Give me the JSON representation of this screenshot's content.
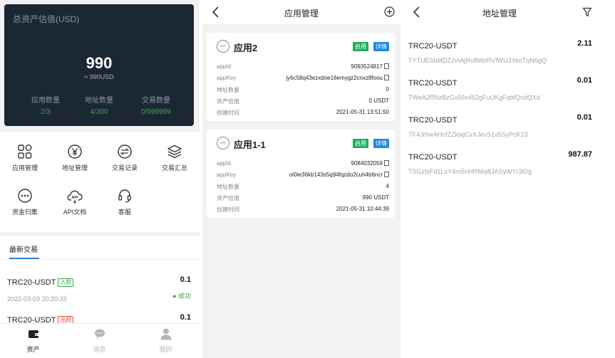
{
  "home": {
    "asset_card": {
      "title": "总资产估值(USD)",
      "value": "990",
      "sub_value": "≈ 990USD",
      "stats": [
        {
          "label": "应用数量",
          "value": "2/3"
        },
        {
          "label": "地址数量",
          "value": "4/300"
        },
        {
          "label": "交易数量",
          "value": "0/999999"
        }
      ]
    },
    "menu": [
      {
        "label": "应用管理",
        "icon": "grid-icon"
      },
      {
        "label": "地址管理",
        "icon": "yen-icon"
      },
      {
        "label": "交易记录",
        "icon": "exchange-icon"
      },
      {
        "label": "交易汇总",
        "icon": "layers-icon"
      },
      {
        "label": "资金归集",
        "icon": "more-dots-icon"
      },
      {
        "label": "API文档",
        "icon": "api-cloud-icon"
      },
      {
        "label": "客服",
        "icon": "headset-icon"
      }
    ],
    "recent": {
      "title": "最新交易",
      "items": [
        {
          "asset": "TRC20-USDT",
          "tag": "入款",
          "amount": "0.1",
          "time": "2022-03-03 20:20:33",
          "status": "● 成功"
        },
        {
          "asset": "TRC20-USDT",
          "tag": "出款",
          "amount": "0.1"
        }
      ]
    },
    "tabbar": [
      {
        "label": "资产",
        "icon": "wallet-icon",
        "active": true
      },
      {
        "label": "消息",
        "icon": "message-icon",
        "active": false
      },
      {
        "label": "我的",
        "icon": "user-icon",
        "active": false
      }
    ],
    "colors": {
      "card_bg": "#1b2733",
      "green": "#3aa652",
      "tab_active": "#222222",
      "tab_inactive": "#b5b5b5"
    }
  },
  "apps": {
    "title": "应用管理",
    "cards": [
      {
        "icon_text": "APP",
        "name": "应用2",
        "status": "启用",
        "detail": "详情",
        "rows": [
          {
            "key": "appId",
            "value": "9093524817"
          },
          {
            "key": "appKey",
            "value": "jy6c58q43ezxdoe16emygz2cnxz8foou"
          },
          {
            "key": "地址数量",
            "value": "0"
          },
          {
            "key": "资产估值",
            "value": "0 USDT"
          },
          {
            "key": "创建时间",
            "value": "2021-05-31 13:51:50"
          }
        ]
      },
      {
        "icon_text": "APP",
        "name": "应用1-1",
        "status": "启用",
        "detail": "详情",
        "rows": [
          {
            "key": "appId",
            "value": "9084032059"
          },
          {
            "key": "appKey",
            "value": "ot0ie36kb143s5q94fqzdo2cuh4b6ncr"
          },
          {
            "key": "地址数量",
            "value": "4"
          },
          {
            "key": "资产估值",
            "value": "990 USDT"
          },
          {
            "key": "创建时间",
            "value": "2021-05-31 10:44:39"
          }
        ]
      }
    ]
  },
  "addresses": {
    "title": "地址管理",
    "items": [
      {
        "asset": "TRC20-USDT",
        "amount": "2.11",
        "address": "TYTUESbMDZ2mAjRc8WoRVfWU3YeoTqN6gQ"
      },
      {
        "asset": "TRC20-USDT",
        "amount": "0.01",
        "address": "TWeA2RNzBzGx56s462gFuUKgFqbfQndQXd"
      },
      {
        "asset": "TRC20-USDT",
        "amount": "0.01",
        "address": "TF4JrhwAHcfZZktxjCvXJevS1v5SyPcK13"
      },
      {
        "asset": "TRC20-USDT",
        "amount": "987.87",
        "address": "TSGzbjFd1LxY4rn5nHRMxj8JASyWYr3iDg"
      }
    ]
  }
}
